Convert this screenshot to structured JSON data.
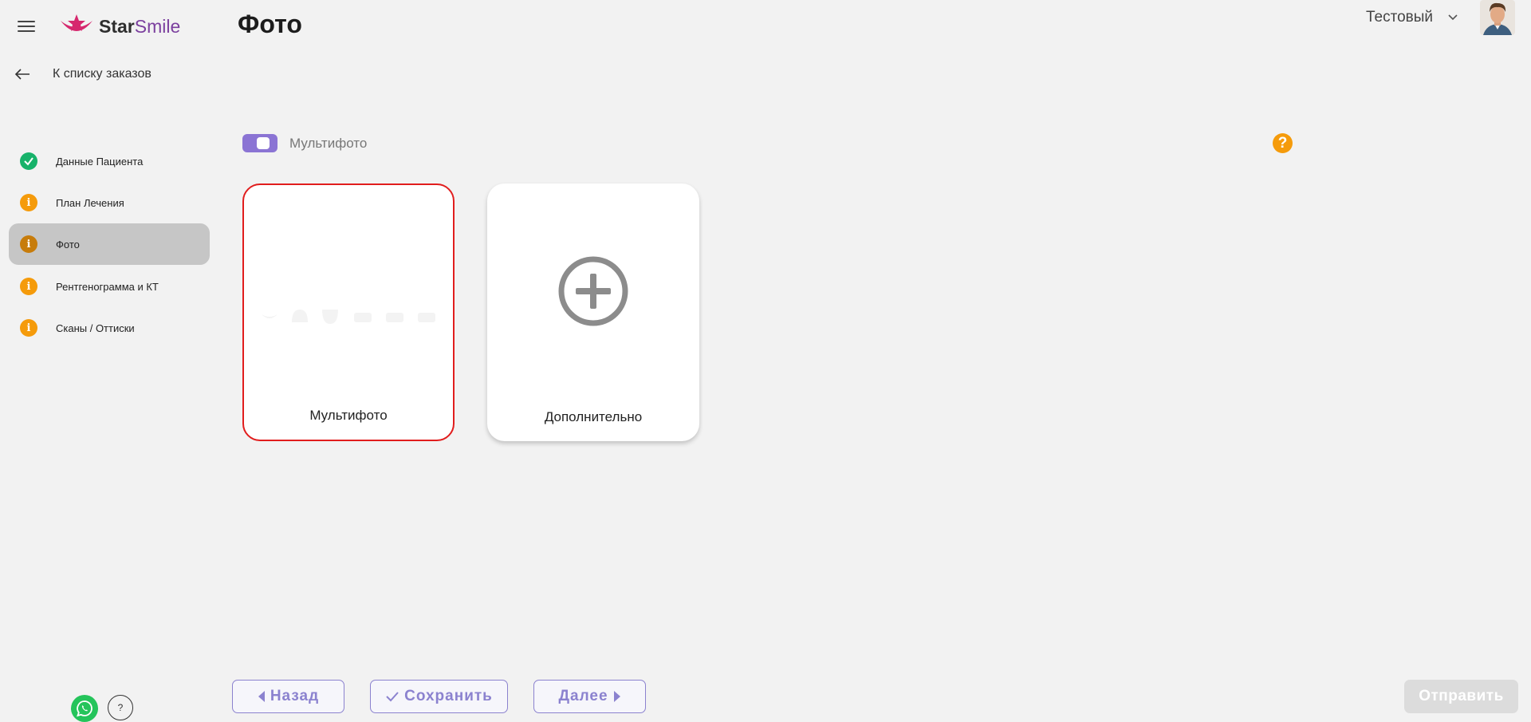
{
  "header": {
    "logo_star": "Star",
    "logo_smile": "Smile",
    "page_title": "Фото",
    "user_name": "Тестовый"
  },
  "back": {
    "label": "К списку заказов"
  },
  "sidebar": {
    "items": [
      {
        "label": "Данные Пациента",
        "status": "done",
        "color": "#17b26a"
      },
      {
        "label": "План Лечения",
        "status": "info",
        "color": "#f59b0b"
      },
      {
        "label": "Фото",
        "status": "info",
        "color": "#d98a0f",
        "active": true
      },
      {
        "label": "Рентгенограмма и КТ",
        "status": "info",
        "color": "#f59b0b"
      },
      {
        "label": "Сканы / Оттиски",
        "status": "info",
        "color": "#f59b0b"
      }
    ]
  },
  "toggle": {
    "label": "Мультифото",
    "on": true
  },
  "help_icon": "?",
  "cards": [
    {
      "label": "Мультифото",
      "selected": true
    },
    {
      "label": "Дополнительно",
      "icon": "plus-circle-icon"
    }
  ],
  "footer": {
    "back_label": "Назад",
    "save_label": "Сохранить",
    "next_label": "Далее",
    "send_label": "Отправить",
    "help_label": "?"
  },
  "colors": {
    "accent": "#8b82cf",
    "toggle": "#8b74d4",
    "selected_border": "#e11d1d",
    "warning": "#f59b0b",
    "success": "#17b26a"
  }
}
